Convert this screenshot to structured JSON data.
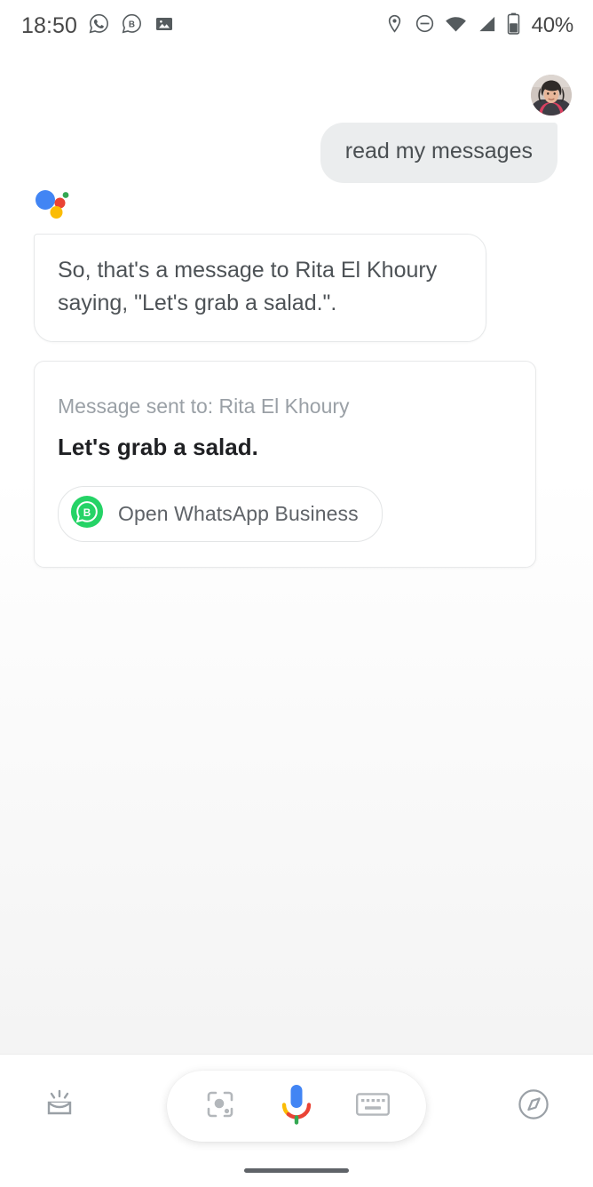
{
  "status_bar": {
    "time": "18:50",
    "battery_percent": "40%",
    "left_icons": [
      "whatsapp-icon",
      "whatsapp-business-icon",
      "photo-icon"
    ],
    "right_icons": [
      "location-icon",
      "do-not-disturb-icon",
      "wifi-icon",
      "cellular-signal-icon",
      "battery-icon"
    ]
  },
  "conversation": {
    "avatar_name": "user-avatar",
    "user_message": "read my messages",
    "assistant_logo": "google-assistant-logo",
    "assistant_message": "So, that's a message to Rita El Khoury saying, \"Let's grab a salad.\".",
    "result_card": {
      "subtitle": "Message sent to: Rita El Khoury",
      "message": "Let's grab a salad.",
      "action_label": "Open WhatsApp Business",
      "action_icon": "whatsapp-business-icon"
    }
  },
  "bottom_bar": {
    "snapshot_icon": "snapshot-icon",
    "lens_icon": "google-lens-icon",
    "mic_icon": "google-mic-icon",
    "keyboard_icon": "keyboard-icon",
    "explore_icon": "explore-compass-icon"
  },
  "colors": {
    "google_blue": "#4285F4",
    "google_red": "#EA4335",
    "google_yellow": "#FBBC05",
    "google_green": "#34A853",
    "whatsapp_green": "#25D366",
    "text_primary": "#1f2023",
    "text_secondary": "#5f6368",
    "text_muted": "#9aa0a6",
    "bubble_gray": "#ebedee"
  }
}
